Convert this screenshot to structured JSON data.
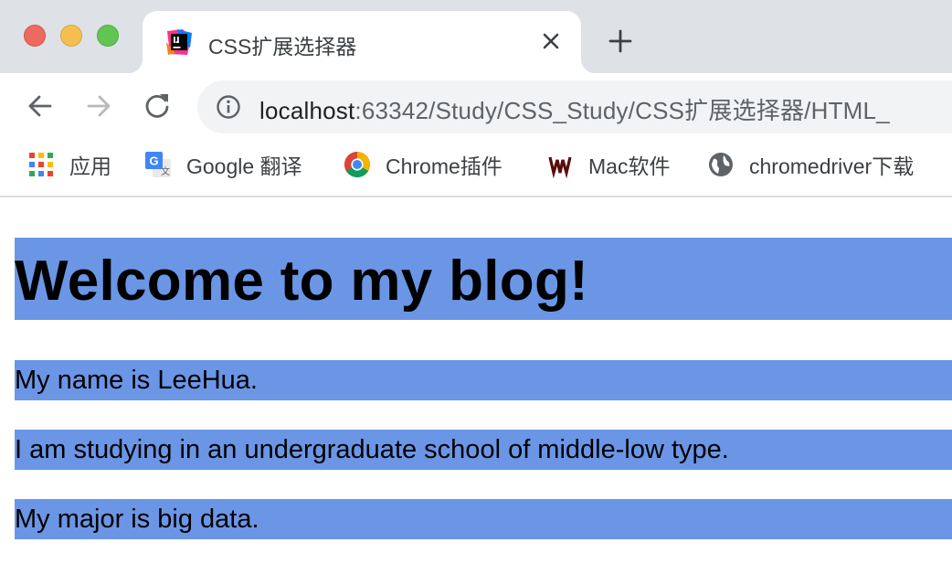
{
  "browser": {
    "tab": {
      "title": "CSS扩展选择器",
      "favicon": "intellij-icon"
    },
    "address": {
      "host": "localhost",
      "rest": ":63342/Study/CSS_Study/CSS扩展选择器/HTML_"
    },
    "bookmarks": [
      {
        "label": "应用",
        "icon": "apps-grid-icon"
      },
      {
        "label": "Google 翻译",
        "icon": "google-translate-icon"
      },
      {
        "label": "Chrome插件",
        "icon": "chrome-icon"
      },
      {
        "label": "Mac软件",
        "icon": "mac-software-icon"
      },
      {
        "label": "chromedriver下载",
        "icon": "globe-icon"
      }
    ]
  },
  "page": {
    "heading": "Welcome to my blog!",
    "paragraphs": [
      "My name is LeeHua.",
      "I am studying in an undergraduate school of middle-low type.",
      "My major is big data."
    ],
    "highlight_color": "#6b96e6"
  }
}
